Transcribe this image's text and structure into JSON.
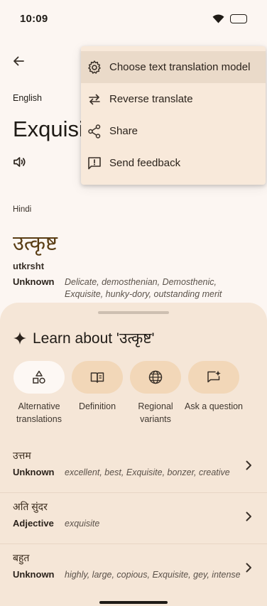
{
  "status_bar": {
    "time": "10:09"
  },
  "source": {
    "language": "English",
    "text": "Exquisite"
  },
  "target": {
    "language": "Hindi",
    "text": "उत्कृष्ट",
    "transliteration": "utkrsht",
    "part_of_speech": "Unknown",
    "synonyms": "Delicate, demosthenian, Demosthenic, Exquisite, hunky-dory, outstanding merit"
  },
  "menu": {
    "items": [
      {
        "label": "Choose text translation model",
        "icon": "gear-icon"
      },
      {
        "label": "Reverse translate",
        "icon": "swap-arrows-icon"
      },
      {
        "label": "Share",
        "icon": "share-icon"
      },
      {
        "label": "Send feedback",
        "icon": "feedback-icon"
      }
    ]
  },
  "learn": {
    "title": "Learn about 'उत्कृष्ट'",
    "chips": [
      {
        "label": "Alternative translations",
        "icon": "shapes-icon"
      },
      {
        "label": "Definition",
        "icon": "book-icon"
      },
      {
        "label": "Regional variants",
        "icon": "globe-icon"
      },
      {
        "label": "Ask a question",
        "icon": "question-chat-icon"
      }
    ],
    "alternatives": [
      {
        "word": "उत्तम",
        "pos": "Unknown",
        "synonyms": "excellent, best, Exquisite, bonzer, creative"
      },
      {
        "word": "अति सुंदर",
        "pos": "Adjective",
        "synonyms": "exquisite"
      },
      {
        "word": "बहुत",
        "pos": "Unknown",
        "synonyms": "highly, large, copious, Exquisite, gey, intense"
      }
    ]
  },
  "colors": {
    "accent_chip": "#f2d7b8",
    "sheet": "#f5e6d7",
    "background": "#fcf6f2"
  }
}
